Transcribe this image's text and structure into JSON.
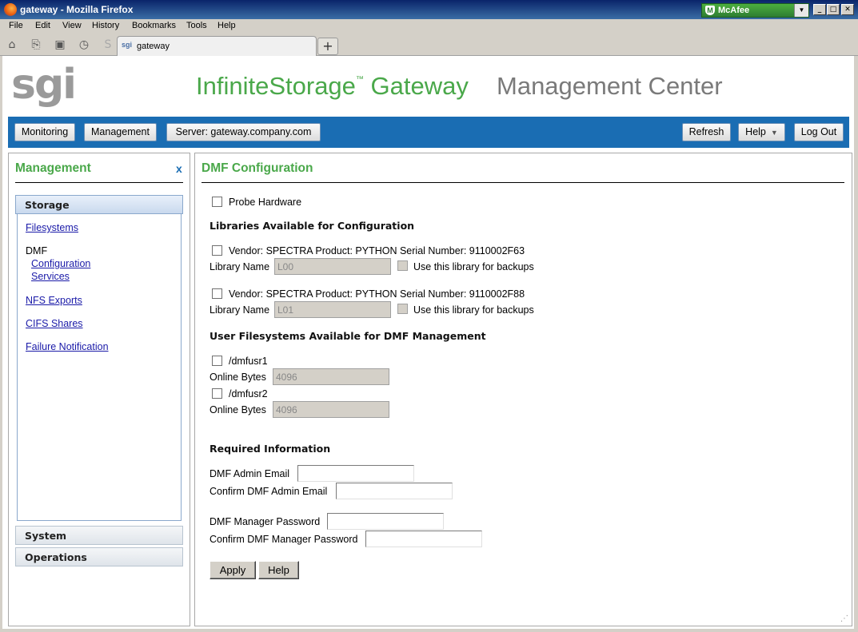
{
  "window": {
    "title": "gateway - Mozilla Firefox",
    "mcafee_label": "McAfee",
    "min_glyph": "_",
    "max_glyph": "□",
    "close_glyph": "✕"
  },
  "menu": [
    "File",
    "Edit",
    "View",
    "History",
    "Bookmarks",
    "Tools",
    "Help"
  ],
  "tab": {
    "favicon_text": "sgi",
    "label": "gateway",
    "new_tab_glyph": "+"
  },
  "header": {
    "logo": "sgi",
    "brand_main": "InfiniteStorage",
    "brand_tm": "™",
    "brand_gateway": " Gateway",
    "brand_secondary": "Management Center"
  },
  "navbar": {
    "monitoring": "Monitoring",
    "management": "Management",
    "server": "Server: gateway.company.com",
    "refresh": "Refresh",
    "help": "Help",
    "logout": "Log Out"
  },
  "sidebar": {
    "title": "Management",
    "close": "x",
    "sections": {
      "storage": "Storage",
      "system": "System",
      "operations": "Operations"
    },
    "links": {
      "filesystems": "Filesystems",
      "dmf": "DMF",
      "configuration": "Configuration",
      "services": "Services",
      "nfs": "NFS Exports",
      "cifs": "CIFS Shares",
      "failure": "Failure Notification"
    }
  },
  "main": {
    "title": "DMF Configuration",
    "probe_label": "Probe Hardware",
    "libraries_heading": "Libraries Available for Configuration",
    "libraries": [
      {
        "desc": "Vendor:  SPECTRA Product: PYTHON Serial Number: 9110002F63",
        "name_label": "Library Name",
        "name_value": "L00",
        "backup_label": "Use this library for backups"
      },
      {
        "desc": "Vendor:  SPECTRA Product: PYTHON Serial Number: 9110002F88",
        "name_label": "Library Name",
        "name_value": "L01",
        "backup_label": "Use this library for backups"
      }
    ],
    "filesystems_heading": "User Filesystems Available for DMF Management",
    "filesystems": [
      {
        "name": "/dmfusr1",
        "bytes_label": "Online Bytes",
        "bytes_value": "4096"
      },
      {
        "name": "/dmfusr2",
        "bytes_label": "Online Bytes",
        "bytes_value": "4096"
      }
    ],
    "required_heading": "Required Information",
    "fields": {
      "admin_email": "DMF Admin Email",
      "confirm_admin_email": "Confirm DMF Admin Email",
      "manager_password": "DMF Manager Password",
      "confirm_manager_password": "Confirm DMF Manager Password"
    },
    "apply": "Apply",
    "help": "Help"
  }
}
